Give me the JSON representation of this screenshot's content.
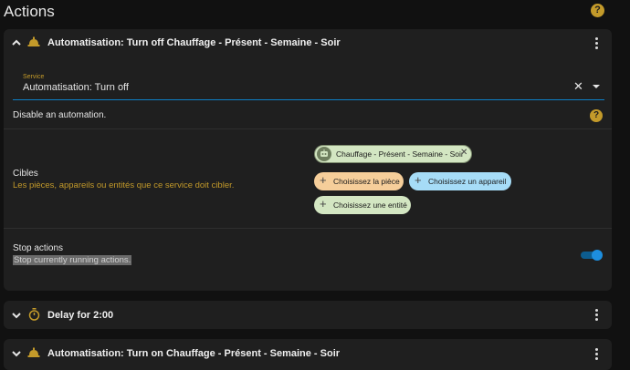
{
  "header": {
    "title": "Actions",
    "help_glyph": "?"
  },
  "cards": [
    {
      "title": "Automatisation: Turn off Chauffage - Présent - Semaine - Soir",
      "icon": "bell-icon",
      "expanded": true,
      "service": {
        "label": "Service",
        "value": "Automatisation: Turn off",
        "clear_glyph": "✕"
      },
      "description": "Disable an automation.",
      "help_glyph": "?",
      "targets": {
        "title": "Cibles",
        "description": "Les pièces, appareils ou entités que ce service doit cibler.",
        "selected_entity": "Chauffage - Présent - Semaine - Soir",
        "remove_glyph": "✕",
        "add_glyph": "+",
        "add_area": "Choisissez la pièce",
        "add_device": "Choisissez un appareil",
        "add_entity": "Choisissez une entité"
      },
      "stop_actions": {
        "title": "Stop actions",
        "description": "Stop currently running actions.",
        "enabled": true
      }
    },
    {
      "title": "Delay for 2:00",
      "icon": "timer-icon",
      "expanded": false
    },
    {
      "title": "Automatisation: Turn on Chauffage - Présent - Semaine - Soir",
      "icon": "bell-icon",
      "expanded": false
    }
  ],
  "colors": {
    "background": "#111111",
    "card": "#1f1f1f",
    "accent": "#c39a2a",
    "primary": "#0d80c6",
    "chip_green": "#d3e6c2",
    "chip_orange": "#f6ce9a",
    "chip_blue": "#a6dcf7"
  }
}
